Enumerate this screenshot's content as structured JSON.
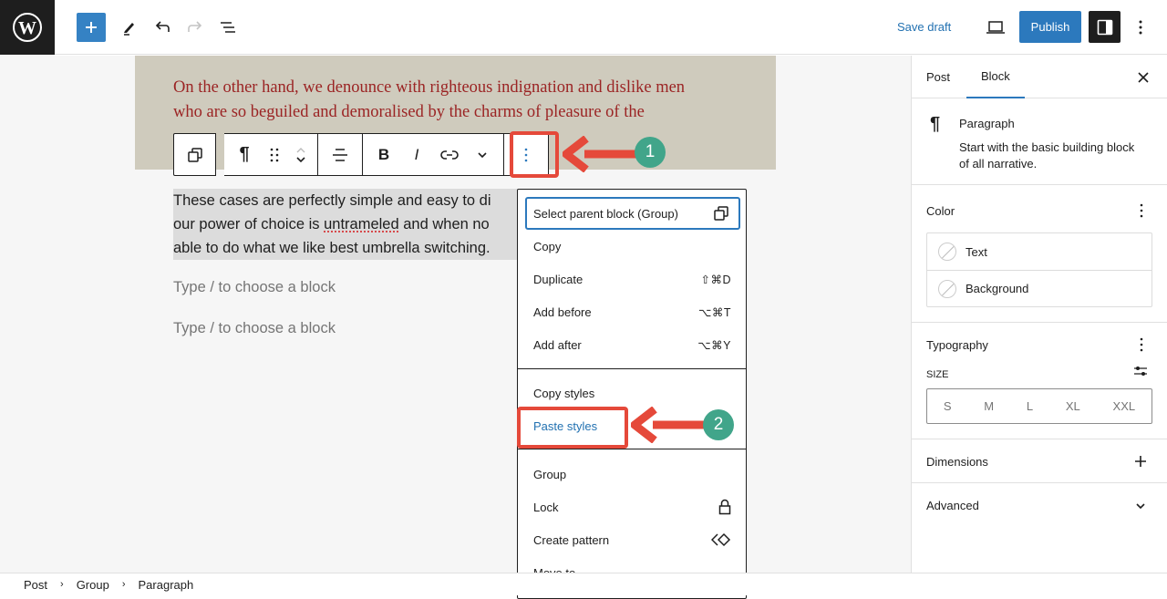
{
  "topbar": {
    "add_block_label": "+",
    "save_draft": "Save draft",
    "publish": "Publish"
  },
  "canvas": {
    "group_text": "On the other hand, we denounce with righteous indignation and dislike men who are so beguiled and demoralised by the charms of pleasure of the moment, so blinded by desire",
    "group_visible_line1": "On the other hand, we denounce with righteous indignation and dislike men",
    "group_visible_line2": "who are so beguiled and demoralised by the charms of pleasure of the",
    "paragraph": {
      "line1": "These cases are perfectly simple and easy to di",
      "line2_before": "our power of choice is ",
      "line2_misspelled": "untrameled",
      "line2_after": " and when no",
      "line3": "able to do what we like best umbrella switching."
    },
    "placeholder_1": "Type / to choose a block",
    "placeholder_2": "Type / to choose a block"
  },
  "block_toolbar": {
    "items": [
      "select-parent",
      "paragraph-type",
      "drag",
      "move-up",
      "move-down",
      "align",
      "bold",
      "italic",
      "link",
      "more-rich-text",
      "options"
    ],
    "bold_label": "B",
    "italic_label": "I",
    "pilcrow": "¶"
  },
  "annotations": {
    "badge_1": "1",
    "badge_2": "2",
    "highlight_color": "#e5493a",
    "badge_color": "#41a58a"
  },
  "options_menu": {
    "section1": [
      {
        "label": "Select parent block (Group)",
        "shortcut": "",
        "icon": "select-parent-icon"
      },
      {
        "label": "Copy",
        "shortcut": ""
      },
      {
        "label": "Duplicate",
        "shortcut": "⇧⌘D"
      },
      {
        "label": "Add before",
        "shortcut": "⌥⌘T"
      },
      {
        "label": "Add after",
        "shortcut": "⌥⌘Y"
      }
    ],
    "section2": [
      {
        "label": "Copy styles"
      },
      {
        "label": "Paste styles"
      }
    ],
    "section3": [
      {
        "label": "Group",
        "icon": ""
      },
      {
        "label": "Lock",
        "icon": "lock-icon"
      },
      {
        "label": "Create pattern",
        "icon": "pattern-icon"
      },
      {
        "label": "Move to",
        "icon": ""
      }
    ]
  },
  "sidebar": {
    "tabs": [
      {
        "label": "Post"
      },
      {
        "label": "Block",
        "active": true
      }
    ],
    "block_card": {
      "title": "Paragraph",
      "description_line1": "Start with the basic building block",
      "description_line2": "of all narrative."
    },
    "color": {
      "title": "Color",
      "items": [
        {
          "label": "Text"
        },
        {
          "label": "Background"
        }
      ]
    },
    "typography": {
      "title": "Typography",
      "size_label": "SIZE",
      "sizes": [
        "S",
        "M",
        "L",
        "XL",
        "XXL"
      ]
    },
    "dimensions": {
      "title": "Dimensions"
    },
    "advanced": {
      "title": "Advanced"
    }
  },
  "breadcrumb": [
    "Post",
    "Group",
    "Paragraph"
  ],
  "colors": {
    "accent": "#2c79bd",
    "dark": "#1e1e1e",
    "group_bg": "#cfcbbd",
    "serif_text": "#9b2424"
  }
}
